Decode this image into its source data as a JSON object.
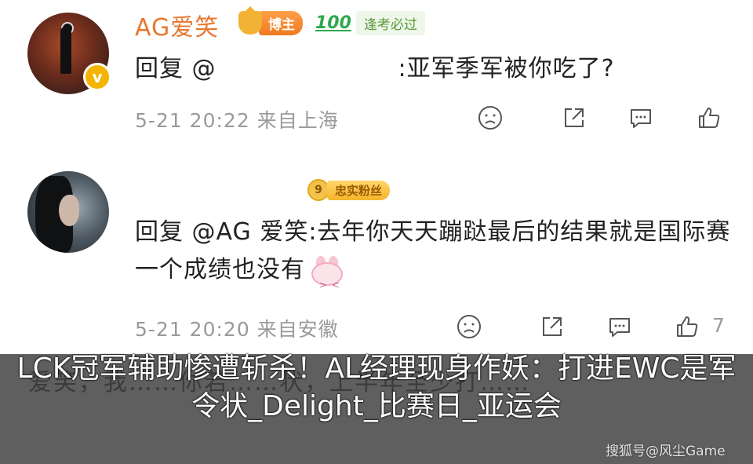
{
  "comments": [
    {
      "username": "AG爱笑",
      "badges": {
        "host": "博主",
        "exam": "逢考必过",
        "exam_icon": "100"
      },
      "reply_prefix": "回复 @",
      "reply_text": ":亚军季军被你吃了?",
      "timestamp": "5-21 20:22",
      "location": "来自上海"
    },
    {
      "fan_badge": {
        "level": "9",
        "label": "忠实粉丝"
      },
      "reply_text": "回复 @AG 爱笑:去年你天天蹦跶最后的结果就是国际赛一个成绩也没有",
      "timestamp": "5-21 20:20",
      "location": "来自安徽",
      "like_count": "7"
    }
  ],
  "overlay": {
    "headline": "LCK冠军辅助惨遭斩杀！AL经理现身作妖：打进EWC是军令状_Delight_比赛日_亚运会",
    "watermark": "搜狐号@风尘Game",
    "background_text": "爱笑，我……你若……状，上半年至少打……"
  },
  "colors": {
    "username": "#e8772e",
    "meta": "#9a9a9a",
    "overlay": "#3c3c3c"
  },
  "icons": [
    "sad-face-icon",
    "share-icon",
    "comment-icon",
    "like-icon"
  ]
}
